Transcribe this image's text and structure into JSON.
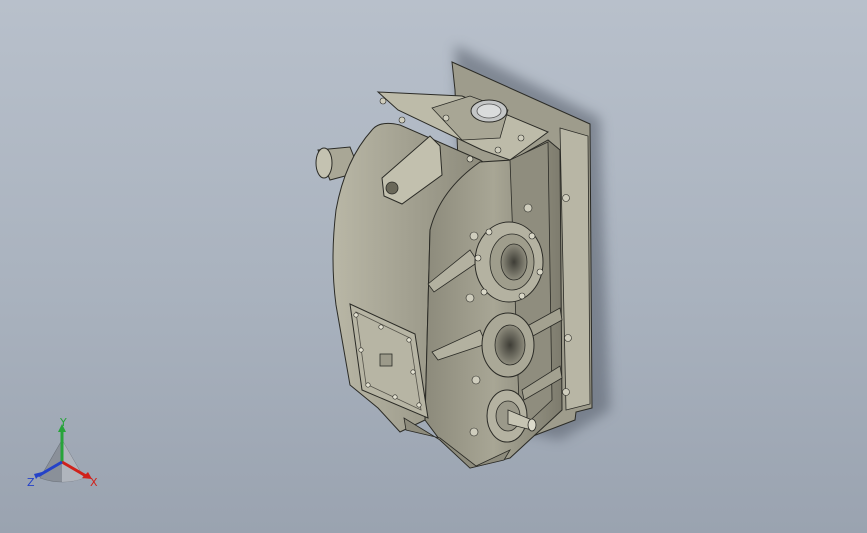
{
  "viewport": {
    "background_top": "#b8c0cb",
    "background_bottom": "#9aa3b0"
  },
  "model": {
    "part": "gearbox-assembly",
    "body_color": "#a6a493",
    "body_dark": "#6f6d60",
    "body_light": "#c9c7b7",
    "edge_color": "#2b2b26"
  },
  "triad": {
    "x_label": "X",
    "y_label": "Y",
    "z_label": "Z",
    "x_color": "#d0221b",
    "y_color": "#27a43a",
    "z_color": "#2442c8"
  }
}
